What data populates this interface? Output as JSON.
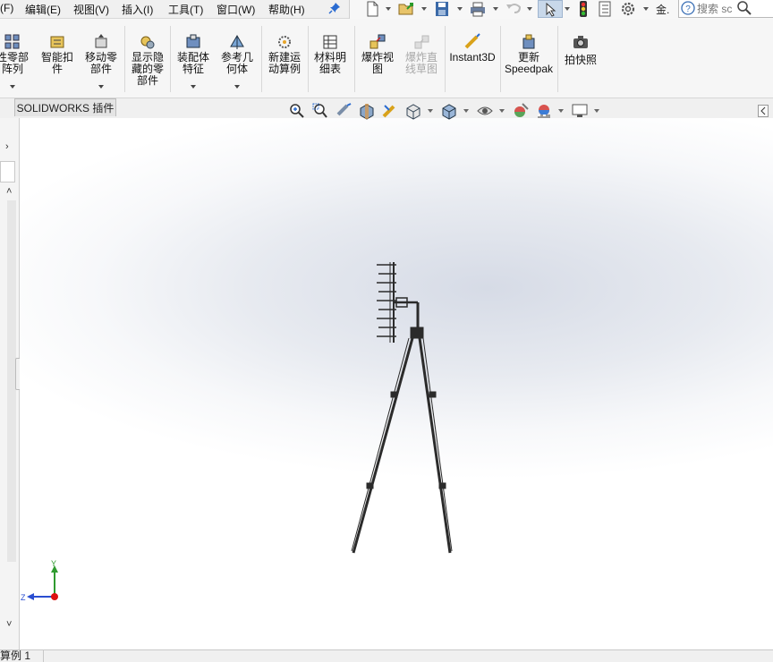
{
  "menubar": {
    "items": [
      "(F)",
      "编辑(E)",
      "视图(V)",
      "插入(I)",
      "工具(T)",
      "窗口(W)",
      "帮助(H)"
    ]
  },
  "quick_access": {
    "icons": [
      "new-document-icon",
      "open-icon",
      "save-icon",
      "print-icon",
      "undo-icon",
      "select-icon",
      "rebuild-icon",
      "file-properties-icon",
      "options-icon"
    ],
    "extra_label": "金.",
    "search_placeholder": "搜索 sc"
  },
  "ribbon": {
    "buttons": [
      {
        "label": "性零部\n阵列",
        "icon": "linear-pattern-icon",
        "dropdown": true
      },
      {
        "label": "智能扣\n件",
        "icon": "smart-fastener-icon",
        "dropdown": false
      },
      {
        "label": "移动零\n部件",
        "icon": "move-component-icon",
        "dropdown": true
      },
      {
        "label": "显示隐\n藏的零\n部件",
        "icon": "show-hidden-icon",
        "dropdown": false
      },
      {
        "label": "装配体\n特征",
        "icon": "assembly-feature-icon",
        "dropdown": true
      },
      {
        "label": "参考几\n何体",
        "icon": "reference-geometry-icon",
        "dropdown": true
      },
      {
        "label": "新建运\n动算例",
        "icon": "new-motion-study-icon",
        "dropdown": false
      },
      {
        "label": "材料明\n细表",
        "icon": "bom-icon",
        "dropdown": false
      },
      {
        "label": "爆炸视\n图",
        "icon": "exploded-view-icon",
        "dropdown": false
      },
      {
        "label": "爆炸直\n线草图",
        "icon": "explode-line-sketch-icon",
        "dropdown": false,
        "disabled": true
      },
      {
        "label": "Instant3D",
        "icon": "instant3d-icon",
        "dropdown": false
      },
      {
        "label": "更新\nSpeedpak",
        "icon": "speedpak-icon",
        "dropdown": false
      },
      {
        "label": "拍快照",
        "icon": "snapshot-icon",
        "dropdown": false
      }
    ]
  },
  "tabs": {
    "active": "SOLIDWORKS 插件"
  },
  "heads_up": {
    "icons": [
      "zoom-to-fit-icon",
      "zoom-to-area-icon",
      "previous-view-icon",
      "section-view-icon",
      "dynamic-annotation-icon",
      "view-orientation-icon",
      "display-style-icon",
      "hide-show-icon",
      "edit-appearance-icon",
      "apply-scene-icon",
      "view-settings-icon"
    ]
  },
  "triad": {
    "x_label": "",
    "y_label": "Y",
    "z_label": "Z"
  },
  "statusbar": {
    "tab_label": "算例 1"
  },
  "colors": {
    "accent": "#1f6fd0",
    "viewport_bg": "#e7eaf0",
    "model": "#2b2b2b"
  }
}
